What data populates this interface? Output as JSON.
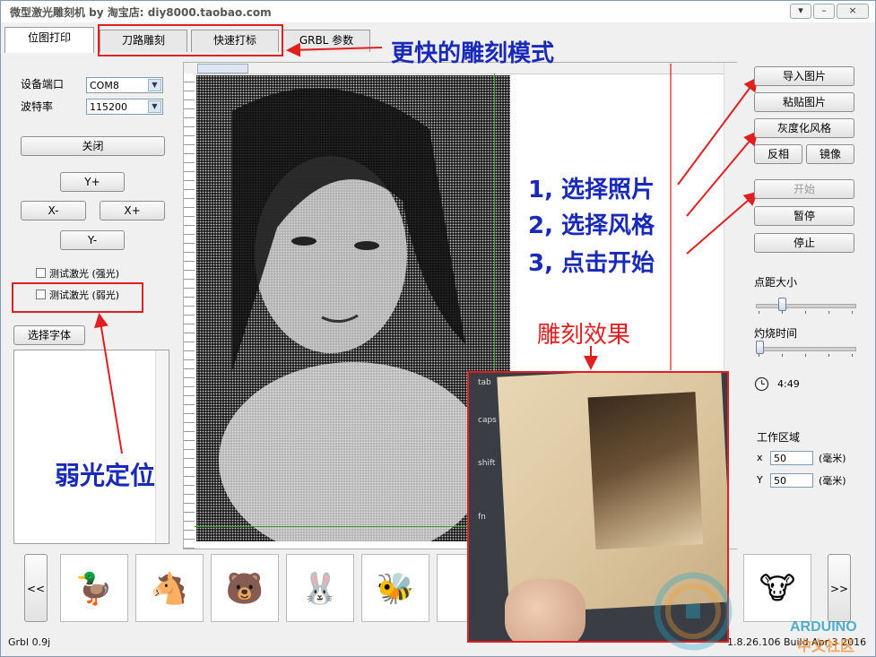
{
  "window": {
    "title": "微型激光雕刻机 by 淘宝店:  diy8000.taobao.com",
    "buttons": {
      "menu": "▾",
      "minimize": "–",
      "close": "×"
    }
  },
  "tabs": [
    {
      "label": "位图打印",
      "active": true
    },
    {
      "label": "刀路雕刻",
      "active": false
    },
    {
      "label": "快速打标",
      "active": false
    },
    {
      "label": "GRBL 参数",
      "active": false
    }
  ],
  "left_panel": {
    "port_label": "设备端口",
    "port_value": "COM8",
    "baud_label": "波特率",
    "baud_value": "115200",
    "close_button": "关闭",
    "jog": {
      "y_plus": "Y+",
      "x_minus": "X-",
      "x_plus": "X+",
      "y_minus": "Y-"
    },
    "test_laser_strong": "测试激光 (强光)",
    "test_laser_weak": "测试激光 (弱光)",
    "select_font": "选择字体"
  },
  "right_panel": {
    "import_image": "导入图片",
    "paste_image": "粘贴图片",
    "grayscale_style": "灰度化风格",
    "invert": "反相",
    "mirror": "镜像",
    "start": "开始",
    "pause": "暂停",
    "stop": "停止",
    "dot_size_label": "点距大小",
    "dot_size_level": 0.25,
    "burn_time_label": "灼烧时间",
    "burn_time_level": 0.0,
    "elapsed_time": "4:49",
    "work_area_label": "工作区域",
    "x_label": "x",
    "x_value": "50",
    "y_label": "Y",
    "y_value": "50",
    "unit": "(毫米)"
  },
  "thumbnails": {
    "prev": "<<",
    "next": ">>",
    "icons": [
      "duck-icon",
      "horse-icon",
      "bear-icon",
      "rabbit-icon",
      "bee-icon",
      "animal-icon",
      "",
      "",
      "",
      "cow-icon"
    ]
  },
  "status_bar": {
    "left": "Grbl 0.9j",
    "right": "1.8.26.106 Build Apr  3 2016"
  },
  "annotations": {
    "faster_mode": "更快的雕刻模式",
    "step1": "1, 选择照片",
    "step2": "2, 选择风格",
    "step3": "3, 点击开始",
    "weak_light": "弱光定位",
    "engraving_effect": "雕刻效果"
  },
  "result_photo": {
    "keys": [
      "tab",
      "caps l",
      "shift",
      "fn"
    ]
  },
  "watermark": {
    "text1": "ARDUINO",
    "text2": "中文社区"
  },
  "colors": {
    "annotation_red": "#e02020",
    "annotation_blue": "#1a2ab8",
    "green_line": "#2aa02a",
    "accent": "#7f9db9"
  }
}
